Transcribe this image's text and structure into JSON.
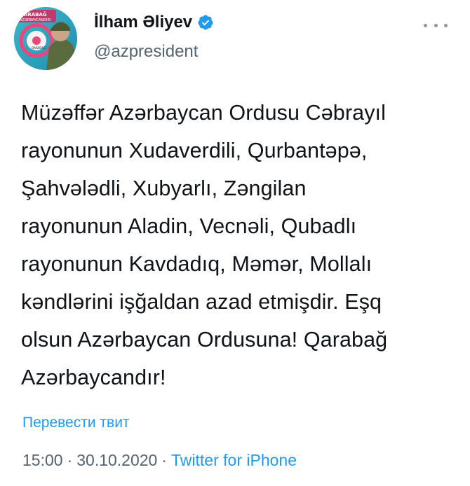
{
  "author": {
    "display_name": "İlham Əliyev",
    "handle": "@azpresident",
    "verified": true,
    "verified_icon": "verified-badge-icon",
    "avatar_text_top": "QARABAĞ",
    "avatar_text_bottom": "AZƏRBAYCANDIR!",
    "avatar_badge_text": "QARABAĞ"
  },
  "menu": {
    "icon": "more-options-icon"
  },
  "tweet": {
    "lines": [
      "Müzəffər Azərbaycan Ordusu Cəbrayıl",
      "rayonunun Xudaverdili, Qurbantəpə,",
      "Şahvələdli, Xubyarlı, Zəngilan",
      "rayonunun Aladin, Vecnəli, Qubadlı",
      "rayonunun Kavdadıq, Məmər, Mollalı",
      "kəndlərini işğaldan azad etmişdir. Eşq",
      "olsun Azərbaycan Ordusuna! Qarabağ",
      "Azərbaycandır!"
    ],
    "translate_label": "Перевести твит",
    "time": "15:00",
    "date": "30.10.2020",
    "separator": "·",
    "source": "Twitter for iPhone"
  },
  "colors": {
    "accent": "#1d9bf0",
    "text": "#0f1419",
    "secondary": "#536471"
  }
}
